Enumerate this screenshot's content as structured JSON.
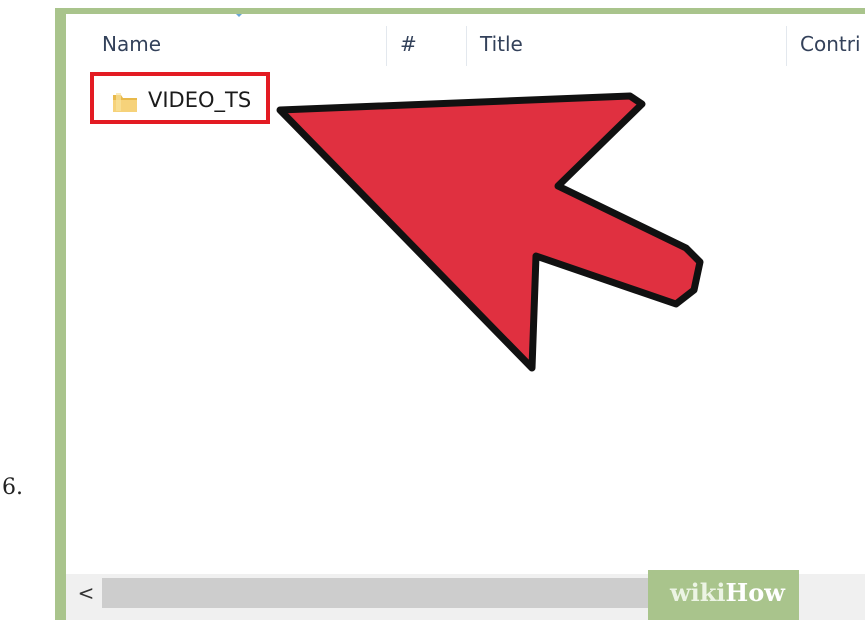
{
  "step": {
    "number": "6."
  },
  "explorer": {
    "columns": [
      {
        "label": "Name"
      },
      {
        "label": "#"
      },
      {
        "label": "Title"
      },
      {
        "label": "Contri"
      }
    ],
    "items": [
      {
        "name": "VIDEO_TS",
        "type": "folder",
        "highlighted": true
      }
    ],
    "scrollbar": {
      "left_arrow": "<"
    }
  },
  "annotation": {
    "arrow_color": "#e03040",
    "highlight_color": "#e31b23"
  },
  "watermark": {
    "part1": "wiki",
    "part2": "How"
  }
}
